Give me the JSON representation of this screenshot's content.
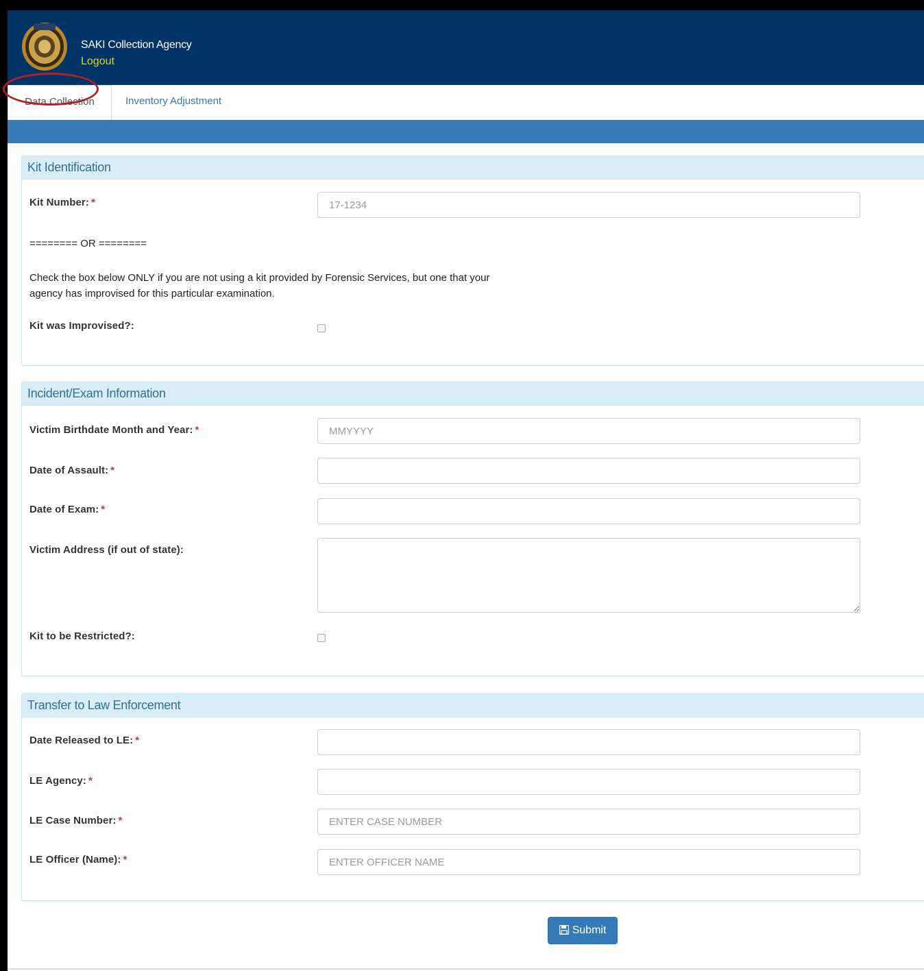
{
  "header": {
    "agency_name": "SAKI Collection Agency",
    "logout_label": "Logout"
  },
  "tabs": [
    {
      "label": "Data Collection",
      "active": true
    },
    {
      "label": "Inventory Adjustment",
      "active": false
    }
  ],
  "kit_identification": {
    "title": "Kit Identification",
    "kit_number_label": "Kit Number:",
    "kit_number_placeholder": "17-1234",
    "or_separator": "======== OR ========",
    "instruction_line1": "Check the box below ONLY if you are not using a kit provided by Forensic Services, but one that your",
    "instruction_line2": "agency has improvised for this particular examination.",
    "improvised_label": "Kit was Improvised?:"
  },
  "incident": {
    "title": "Incident/Exam Information",
    "birthdate_label": "Victim Birthdate Month and Year:",
    "birthdate_placeholder": "MMYYYY",
    "assault_date_label": "Date of Assault:",
    "exam_date_label": "Date of Exam:",
    "address_label": "Victim Address (if out of state):",
    "restricted_label": "Kit to be Restricted?:"
  },
  "transfer": {
    "title": "Transfer to Law Enforcement",
    "released_label": "Date Released to LE:",
    "agency_label": "LE Agency:",
    "case_number_label": "LE Case Number:",
    "case_number_placeholder": "ENTER CASE NUMBER",
    "officer_label": "LE Officer (Name):",
    "officer_placeholder": "ENTER OFFICER NAME"
  },
  "required_marker": "*",
  "submit_label": "Submit",
  "colors": {
    "header_bg": "#003366",
    "primary": "#337ab7",
    "panel_heading_bg": "#d9edf7",
    "panel_heading_text": "#31708f",
    "required": "#a94442",
    "logout": "#d8d82a",
    "highlight_circle": "#b51f24"
  }
}
